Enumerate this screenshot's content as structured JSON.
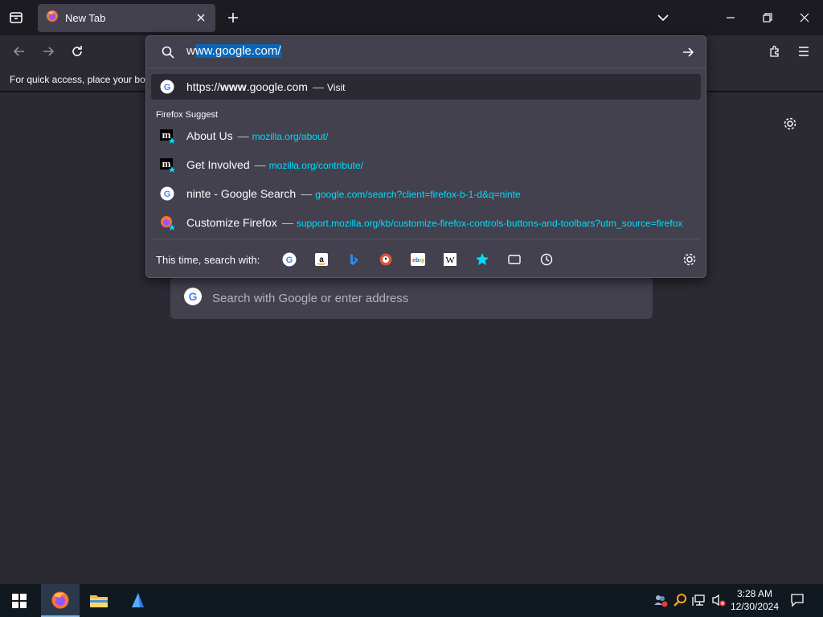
{
  "tab": {
    "title": "New Tab"
  },
  "bookmarks": {
    "text": "For quick access, place your boo"
  },
  "urlbar": {
    "typed": "w",
    "selected": "ww.google.com/"
  },
  "results": [
    {
      "prefix": "https://",
      "bold": "www",
      "rest": ".google.com",
      "action": "Visit",
      "icon": "google-icon"
    }
  ],
  "suggest": {
    "label": "Firefox Suggest",
    "items": [
      {
        "title": "About Us",
        "url": "mozilla.org/about/",
        "icon": "mozilla-bookmark-icon"
      },
      {
        "title": "Get Involved",
        "url": "mozilla.org/contribute/",
        "icon": "mozilla-bookmark-icon"
      },
      {
        "title": "ninte - Google Search",
        "url": "google.com/search?client=firefox-b-1-d&q=ninte",
        "icon": "google-icon"
      },
      {
        "title": "Customize Firefox",
        "url": "support.mozilla.org/kb/customize-firefox-controls-buttons-and-toolbars?utm_source=firefox",
        "icon": "firefox-bookmark-icon"
      }
    ]
  },
  "footer": {
    "label": "This time, search with:",
    "engines": [
      "google-icon",
      "amazon-icon",
      "bing-icon",
      "duckduckgo-icon",
      "ebay-icon",
      "wikipedia-icon",
      "bookmarks-star-icon",
      "tabs-icon",
      "history-icon"
    ]
  },
  "content": {
    "search_placeholder": "Search with Google or enter address"
  },
  "taskbar": {
    "time": "3:28 AM",
    "date": "12/30/2024"
  },
  "colors": {
    "link": "#00ddff",
    "panel": "#42414d",
    "toolbar": "#2b2a33",
    "selection": "#0b66b8"
  }
}
